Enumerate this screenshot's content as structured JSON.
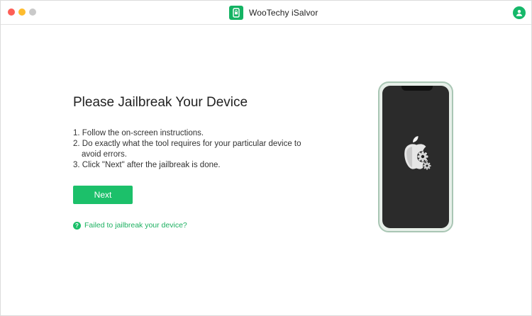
{
  "window": {
    "title": "WooTechy iSalvor"
  },
  "main": {
    "heading": "Please Jailbreak Your Device",
    "steps": [
      {
        "line1": "1. Follow the on-screen instructions.",
        "line2": ""
      },
      {
        "line1": "2. Do exactly what the tool requires for your particular device to",
        "line2": "avoid errors."
      },
      {
        "line1": "3. Click \"Next\" after the jailbreak is done.",
        "line2": ""
      }
    ],
    "next_label": "Next",
    "help_label": "Failed to jailbreak your device?",
    "help_icon_glyph": "?"
  },
  "colors": {
    "accent": "#1cc06a",
    "close": "#fd5f57",
    "minimize": "#febc2e",
    "maximize": "#c9c9c9"
  },
  "icons": {
    "app_logo": "lock-phone-icon",
    "user": "user-account-icon",
    "device_screen": "apple-jailbreak-gear-icon",
    "help": "question-circle-icon"
  }
}
